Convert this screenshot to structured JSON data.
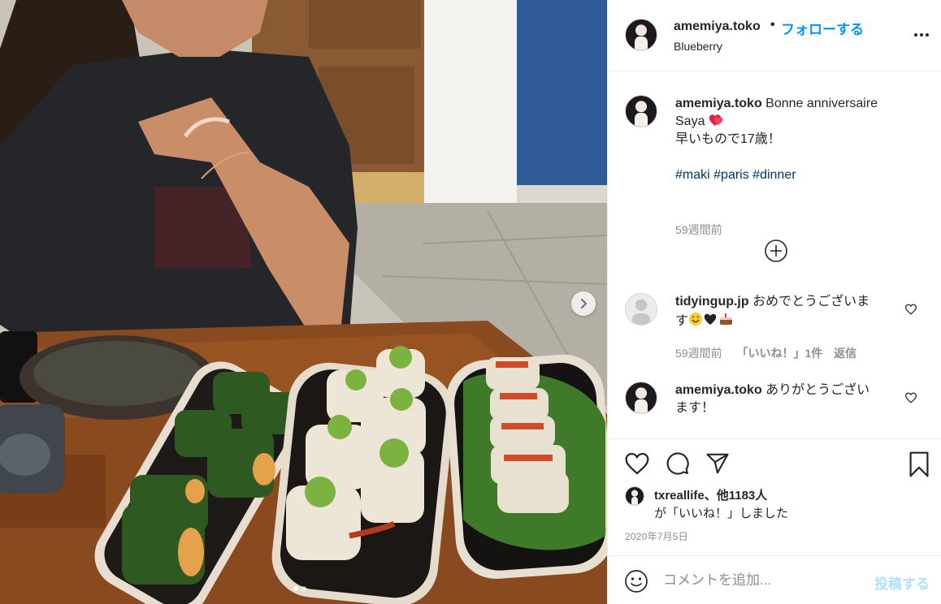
{
  "post": {
    "username": "amemiya.toko",
    "separator": "•",
    "follow_label": "フォローする",
    "location": "Blueberry",
    "photo_alt": "sushi dinner photo",
    "carousel": {
      "current": 1,
      "total": 2
    }
  },
  "caption": {
    "username": "amemiya.toko",
    "text_line1": "Bonne anniversaire",
    "text_line2": "Saya",
    "text_line2_emoji": "heart-emoji",
    "text_line3": "早いもので17歳！",
    "hashtags": [
      "#maki",
      "#paris",
      "#dinner"
    ],
    "time": "59週間前"
  },
  "comments": [
    {
      "username": "tidyingup.jp",
      "text_line1": "おめでとうございま",
      "text_line2": "す",
      "emojis": [
        "smile-emoji",
        "black-heart-emoji",
        "cake-emoji"
      ],
      "time": "59週間前",
      "likes": "「いいね！」1件",
      "reply": "返信"
    },
    {
      "username": "amemiya.toko",
      "text_line1": "ありがとうござい",
      "text_line2": "ます！"
    }
  ],
  "actions": {
    "icons": [
      "heart-icon",
      "comment-icon",
      "share-icon",
      "bookmark-icon"
    ]
  },
  "likes": {
    "liker": "txreallife",
    "separator": "、",
    "others": "他1183人",
    "suffix": "が「いいね！」しました"
  },
  "date": "2020年7月5日",
  "add_comment": {
    "placeholder": "コメントを追加...",
    "post_label": "投稿する"
  },
  "colors": {
    "link_blue": "#0095f6",
    "hashtag": "#00376b",
    "meta_grey": "#8e8e8e",
    "post_disabled": "#b2dffc"
  }
}
